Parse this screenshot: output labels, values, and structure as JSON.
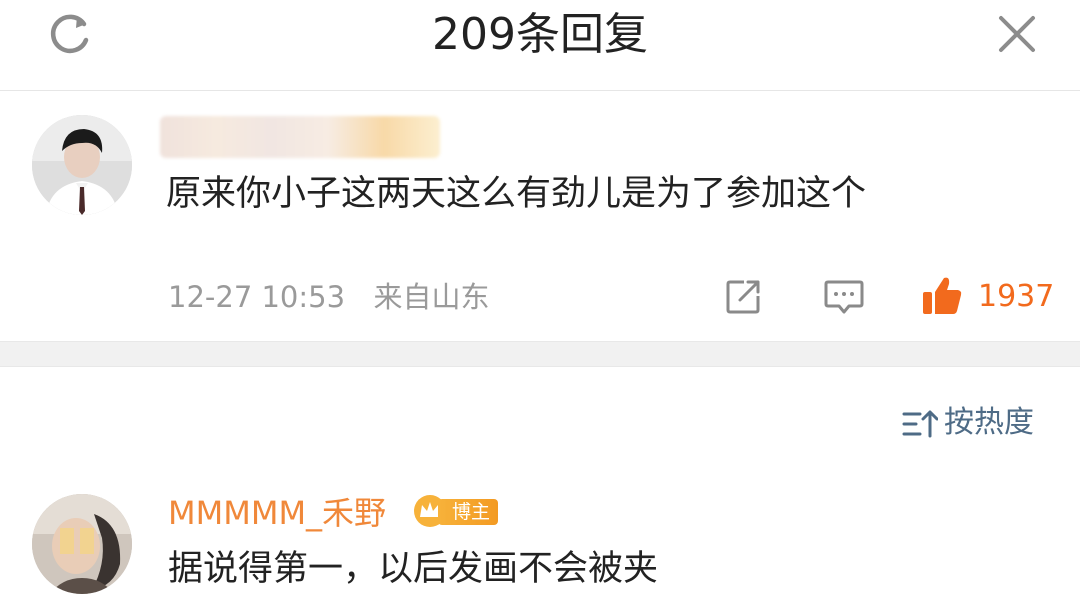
{
  "header": {
    "title": "209条回复",
    "refresh_icon": "refresh-icon",
    "close_icon": "close-icon"
  },
  "post": {
    "avatar": "avatar-photo",
    "username_blurred": true,
    "text": "原来你小子这两天这么有劲儿是为了参加这个",
    "timestamp": "12-27 10:53",
    "location": "来自山东",
    "share_icon": "share-icon",
    "comment_icon": "comment-icon",
    "like_icon": "thumbs-up-icon",
    "like_count": "1937",
    "accent_color": "#f26a1d"
  },
  "sort": {
    "icon": "sort-icon",
    "label": "按热度"
  },
  "reply": {
    "username": "MMMMM_禾野",
    "badge_icon": "crown-icon",
    "badge_label": "博主",
    "text": "据说得第一，以后发画不会被夹"
  }
}
